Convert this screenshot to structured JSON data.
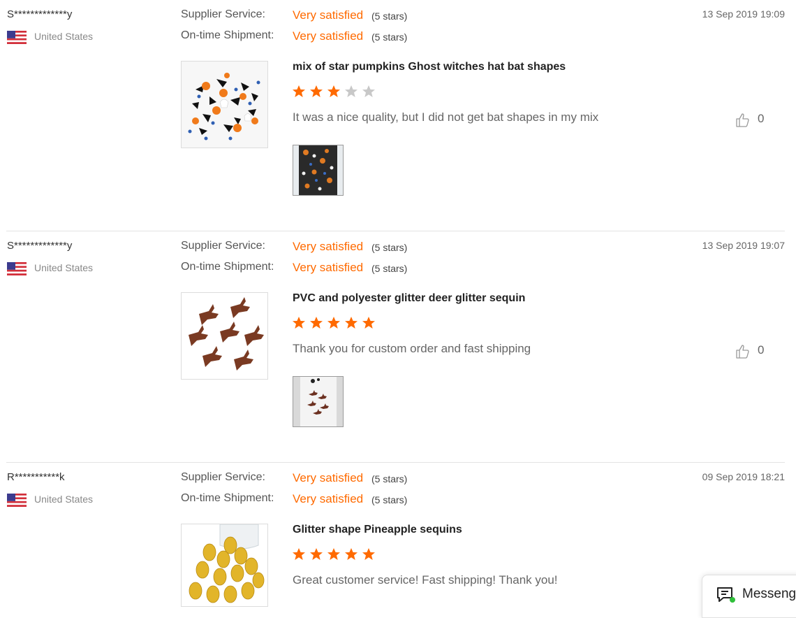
{
  "reviews": [
    {
      "user": "S*************y",
      "country": "United States",
      "supplier_service": {
        "label": "Supplier Service:",
        "value": "Very satisfied",
        "stars": "(5 stars)"
      },
      "shipment": {
        "label": "On-time Shipment:",
        "value": "Very satisfied",
        "stars": "(5 stars)"
      },
      "date": "13 Sep 2019 19:09",
      "product_title": "mix of star pumpkins Ghost witches hat bat shapes",
      "rating": 3,
      "comment": "It was a nice quality, but I did not get bat shapes in my mix",
      "helpful_count": "0",
      "product_image_icon": "halloween-confetti-image",
      "photo_icon": "buyer-photo-confetti"
    },
    {
      "user": "S*************y",
      "country": "United States",
      "supplier_service": {
        "label": "Supplier Service:",
        "value": "Very satisfied",
        "stars": "(5 stars)"
      },
      "shipment": {
        "label": "On-time Shipment:",
        "value": "Very satisfied",
        "stars": "(5 stars)"
      },
      "date": "13 Sep 2019 19:07",
      "product_title": "PVC and polyester glitter deer glitter sequin",
      "rating": 5,
      "comment": "Thank you for custom order and fast shipping",
      "helpful_count": "0",
      "product_image_icon": "deer-sequin-image",
      "photo_icon": "buyer-photo-deer"
    },
    {
      "user": "R***********k",
      "country": "United States",
      "supplier_service": {
        "label": "Supplier Service:",
        "value": "Very satisfied",
        "stars": "(5 stars)"
      },
      "shipment": {
        "label": "On-time Shipment:",
        "value": "Very satisfied",
        "stars": "(5 stars)"
      },
      "date": "09 Sep 2019 18:21",
      "product_title": "Glitter shape Pineapple sequins",
      "rating": 5,
      "comment": "Great customer service!  Fast shipping!  Thank you!",
      "product_image_icon": "pineapple-sequin-image"
    }
  ],
  "messenger": {
    "label": "Messenger"
  },
  "colors": {
    "accent": "#ff6a00",
    "star_empty": "#c8c8c8",
    "divider": "#e3e3e3"
  }
}
